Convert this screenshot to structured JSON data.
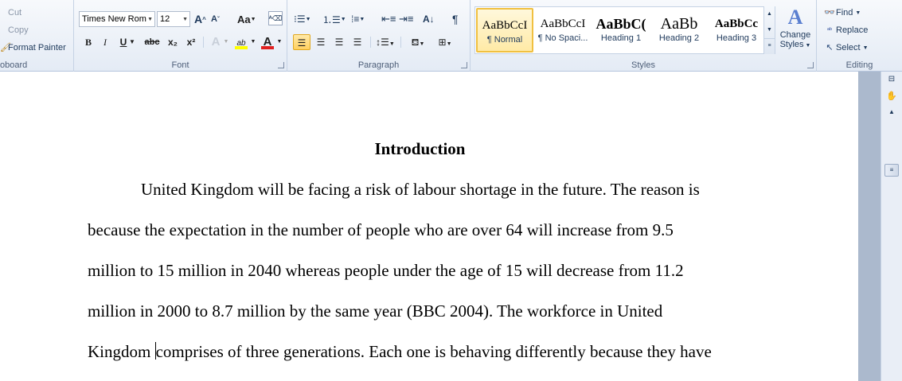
{
  "ribbon": {
    "clipboard": {
      "label": "oboard",
      "cut": "Cut",
      "copy": "Copy",
      "format_painter": "Format Painter"
    },
    "font": {
      "label": "Font",
      "font_name": "Times New Rom",
      "font_size": "12",
      "grow": "A",
      "shrink": "A",
      "change_case": "Aa",
      "bold": "B",
      "italic": "I",
      "underline": "U",
      "strike": "abc",
      "subscript": "x₂",
      "superscript": "x²",
      "text_effects": "A",
      "highlight": "ab",
      "font_color": "A"
    },
    "paragraph": {
      "label": "Paragraph",
      "show_marks": "¶"
    },
    "styles": {
      "label": "Styles",
      "tiles": [
        {
          "sample": "AaBbCcI",
          "name": "¶ Normal"
        },
        {
          "sample": "AaBbCcI",
          "name": "¶ No Spaci..."
        },
        {
          "sample": "AaBbC(",
          "name": "Heading 1"
        },
        {
          "sample": "AaBb",
          "name": "Heading 2"
        },
        {
          "sample": "AaBbCc",
          "name": "Heading 3"
        }
      ],
      "change_styles_line1": "Change",
      "change_styles_line2": "Styles"
    },
    "editing": {
      "label": "Editing",
      "find": "Find",
      "replace": "Replace",
      "select": "Select"
    }
  },
  "document": {
    "heading": "Introduction",
    "lines": [
      "United Kingdom will be facing a risk of labour shortage in the future. The reason is",
      "because the expectation in the number of people who are over 64 will increase from 9.5",
      "million to 15 million in 2040 whereas people under the age of 15 will decrease from 11.2",
      "million in 2000 to 8.7 million by the same year (BBC 2004). The workforce in United"
    ],
    "last_line_before_caret": "Kingdom ",
    "last_line_after_caret": "comprises of three generations. Each one is behaving differently  because they have"
  },
  "colors": {
    "highlight_yellow": "#ffff00",
    "font_red": "#e02020",
    "active_style_border": "#f0c040"
  }
}
